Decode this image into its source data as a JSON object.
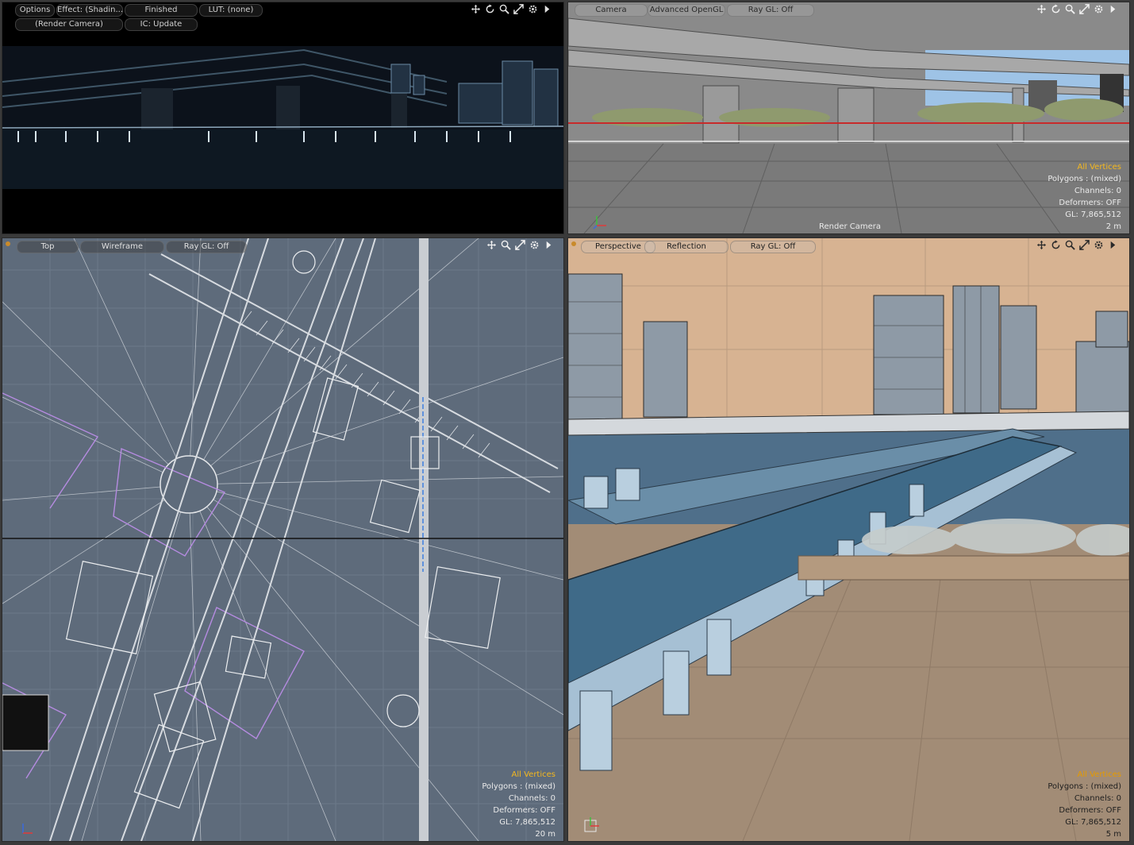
{
  "viewports": {
    "render": {
      "options_label": "Options",
      "effect_label": "Effect: (Shadin...",
      "status_label": "Finished",
      "lut_label": "LUT: (none)",
      "camera_label": "(Render Camera)",
      "ic_label": "IC: Update"
    },
    "camera": {
      "view_label": "Camera",
      "shading_label": "Advanced OpenGL",
      "raygl_label": "Ray GL: Off",
      "info": {
        "selection": "All Vertices",
        "polygons": "Polygons : (mixed)",
        "channels": "Channels: 0",
        "deformers": "Deformers: OFF",
        "gl": "GL: 7,865,512"
      },
      "camera_name": "Render Camera",
      "scale": "2 m"
    },
    "top": {
      "view_label": "Top",
      "shading_label": "Wireframe",
      "raygl_label": "Ray GL: Off",
      "info": {
        "selection": "All Vertices",
        "polygons": "Polygons : (mixed)",
        "channels": "Channels: 0",
        "deformers": "Deformers: OFF",
        "gl": "GL: 7,865,512"
      },
      "scale": "20 m"
    },
    "perspective": {
      "view_label": "Perspective",
      "shading_label": "Reflection",
      "raygl_label": "Ray GL: Off",
      "info": {
        "selection": "All Vertices",
        "polygons": "Polygons : (mixed)",
        "channels": "Channels: 0",
        "deformers": "Deformers: OFF",
        "gl": "GL: 7,865,512"
      },
      "scale": "5 m"
    }
  },
  "icons": [
    "move-icon",
    "rotate-icon",
    "zoom-icon",
    "maximize-icon",
    "gear-icon",
    "arrow-right-icon"
  ],
  "colors": {
    "selection_highlight": "#f5b81e",
    "top_view_bg": "#5e6b7b",
    "perspective_bg": "#c2a68a",
    "camera_view_bg": "#7f7f7f"
  }
}
